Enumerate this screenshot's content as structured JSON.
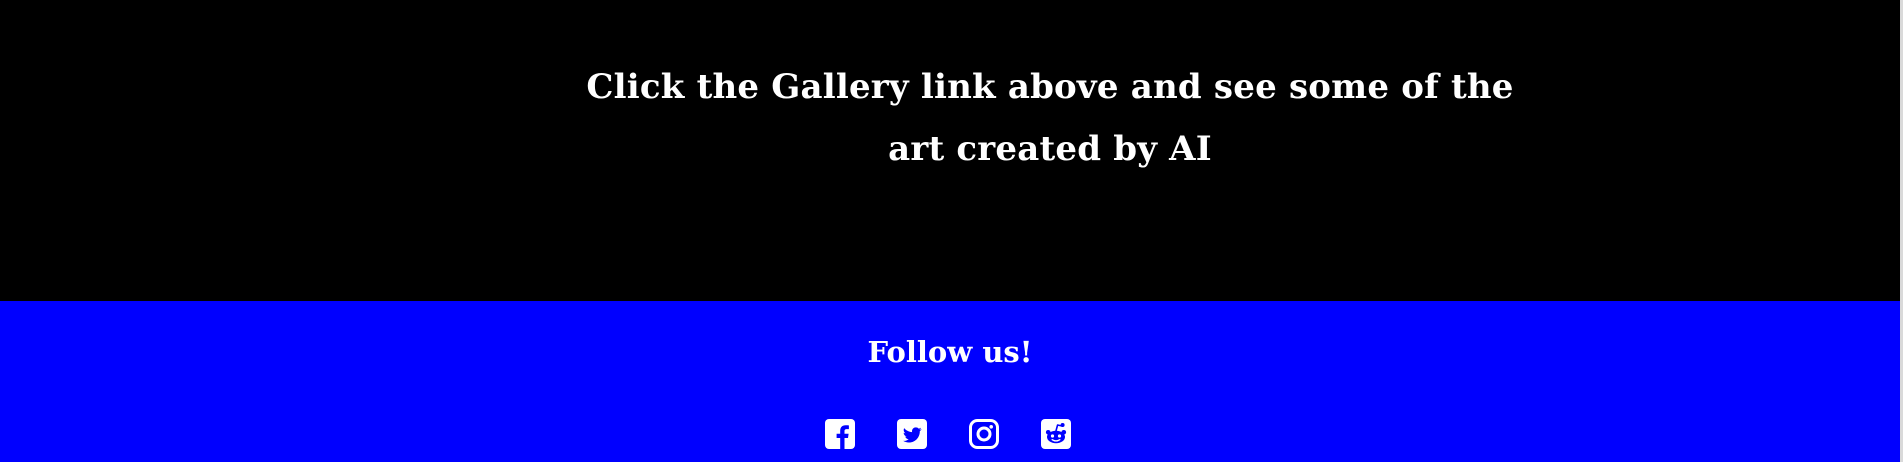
{
  "hero": {
    "text": "Click the Gallery link above and see some of the art created by AI"
  },
  "footer": {
    "title": "Follow us!",
    "social_links": [
      {
        "label": "Facebook",
        "icon": "facebook-icon"
      },
      {
        "label": "Twitter",
        "icon": "twitter-icon"
      },
      {
        "label": "Instagram",
        "icon": "instagram-icon"
      },
      {
        "label": "Reddit",
        "icon": "reddit-icon"
      }
    ]
  },
  "colors": {
    "hero_background": "#000000",
    "footer_background": "#0000ff",
    "text": "#ffffff"
  }
}
